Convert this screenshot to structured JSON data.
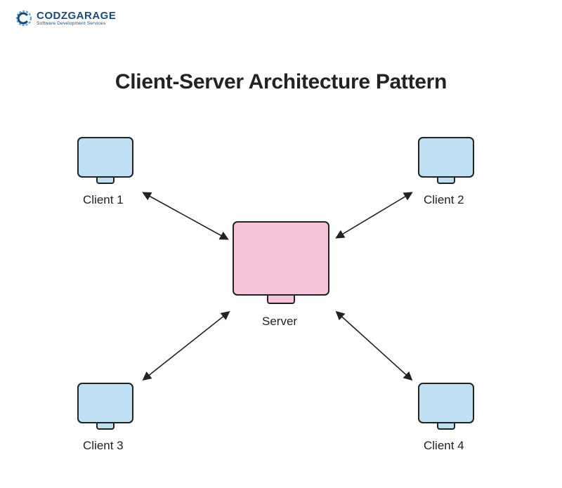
{
  "logo": {
    "text_main": "CODZGARAGE",
    "text_sub": "Software Development Services",
    "accent_color": "#2b7fbf"
  },
  "title": "Client-Server Architecture Pattern",
  "nodes": {
    "client1": {
      "label": "Client 1"
    },
    "client2": {
      "label": "Client 2"
    },
    "client3": {
      "label": "Client 3"
    },
    "client4": {
      "label": "Client 4"
    },
    "server": {
      "label": "Server"
    }
  },
  "colors": {
    "client_fill": "#bfe0f2",
    "server_fill": "#f5c4db",
    "stroke": "#222222"
  }
}
